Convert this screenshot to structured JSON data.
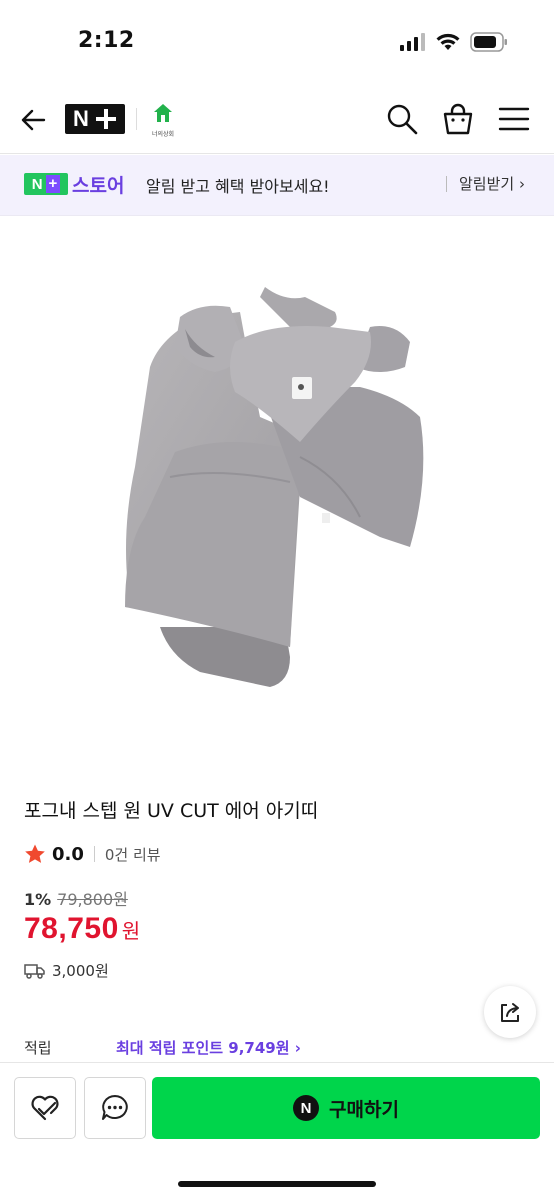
{
  "status_bar": {
    "time": "2:12"
  },
  "nav": {
    "logo_text": "N",
    "home_label": "너의상회"
  },
  "banner": {
    "badge_n": "N",
    "badge_plus": "+",
    "store": "스토어",
    "message": "알림 받고 혜택 받아보세요!",
    "cta": "알림받기 ›"
  },
  "product": {
    "title": "포그내 스텝 원 UV CUT 에어 아기띠",
    "rating": "0.0",
    "reviews": "0건 리뷰",
    "discount": "1%",
    "original_price": "79,800원",
    "price": "78,750",
    "price_unit": "원",
    "shipping": "3,000원"
  },
  "points": {
    "label": "적립",
    "value": "최대 적립 포인트 9,749원 ›"
  },
  "bottom_bar": {
    "buy_icon": "N",
    "buy_label": "구매하기"
  },
  "colors": {
    "price_red": "#e0142f",
    "brand_green": "#00d54b",
    "accent_purple": "#6a3fe0"
  }
}
